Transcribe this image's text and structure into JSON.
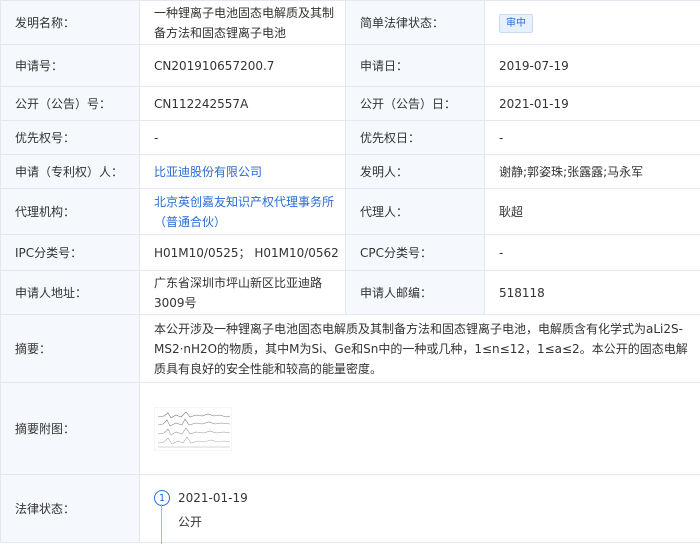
{
  "rows": {
    "title": {
      "label": "发明名称：",
      "value": "一种锂离子电池固态电解质及其制备方法和固态锂离子电池",
      "label2": "简单法律状态：",
      "value2": "审中"
    },
    "app_no": {
      "label": "申请号：",
      "value": "CN201910657200.7",
      "label2": "申请日：",
      "value2": "2019-07-19"
    },
    "pub_no": {
      "label": "公开（公告）号：",
      "value": "CN112242557A",
      "label2": "公开（公告）日：",
      "value2": "2021-01-19"
    },
    "priority": {
      "label": "优先权号：",
      "value": "-",
      "label2": "优先权日：",
      "value2": "-"
    },
    "applicant": {
      "label": "申请（专利权）人：",
      "value": "比亚迪股份有限公司",
      "label2": "发明人：",
      "value2": "谢静;郭姿珠;张露露;马永军"
    },
    "agency": {
      "label": "代理机构：",
      "value": "北京英创嘉友知识产权代理事务所（普通合伙）",
      "label2": "代理人：",
      "value2": "耿超"
    },
    "ipc": {
      "label": "IPC分类号：",
      "value": "H01M10/0525； H01M10/0562",
      "label2": "CPC分类号：",
      "value2": "-"
    },
    "address": {
      "label": "申请人地址：",
      "value": "广东省深圳市坪山新区比亚迪路3009号",
      "label2": "申请人邮编：",
      "value2": "518118"
    },
    "abstract": {
      "label": "摘要：",
      "value": "本公开涉及一种锂离子电池固态电解质及其制备方法和固态锂离子电池，电解质含有化学式为aLi2S-MS2·nH2O的物质，其中M为Si、Ge和Sn中的一种或几种，1≤n≤12，1≤a≤2。本公开的固态电解质具有良好的安全性能和较高的能量密度。"
    },
    "abstract_img": {
      "label": "摘要附图："
    },
    "legal": {
      "label": "法律状态：",
      "events": [
        {
          "num": "1",
          "date": "2021-01-19",
          "status": "公开"
        }
      ]
    }
  },
  "colors": {
    "label_bg": "#f5f8fc",
    "link": "#2a6bd6",
    "border": "#e4e8ee"
  }
}
